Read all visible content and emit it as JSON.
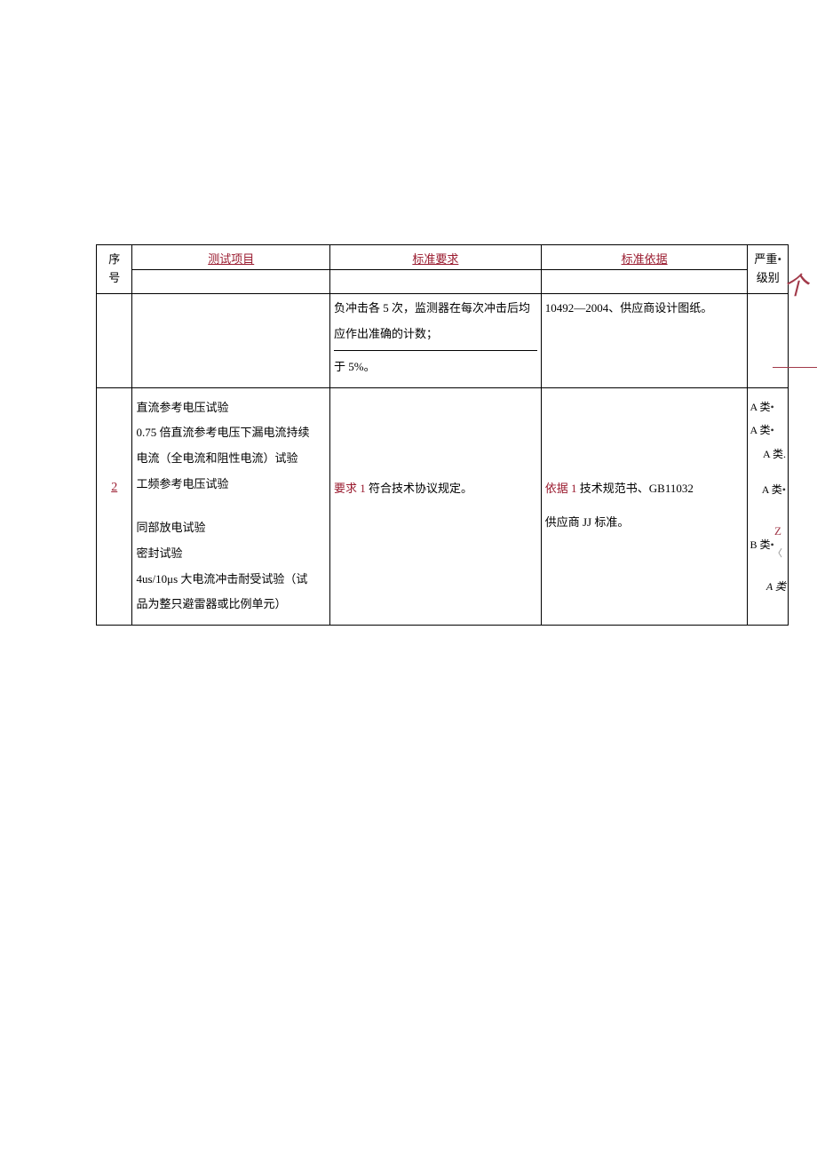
{
  "headers": {
    "seq": "序\n号",
    "seq_top": "序",
    "seq_bot": "号",
    "item": "测试项目",
    "req": "标准要求",
    "basis": "标准依据",
    "sev": "严重",
    "sev_top": "严重",
    "sev_bot": "级别"
  },
  "row1": {
    "req_top": "负冲击各 5 次，监测器在每次冲击后均应作出准确的计数；",
    "req_bot": "于 5%。",
    "basis": "10492—2004、供应商设计图纸。"
  },
  "row2": {
    "seq": "2",
    "item_top": "直流参考电压试验\n0.75 倍直流参考电压下漏电流持续电流（全电流和阻性电流）试验\n工频参考电压试验",
    "item_line1": "直流参考电压试验",
    "item_line2": "0.75 倍直流参考电压下漏电流持续",
    "item_line3": "电流（全电流和阻性电流）试验",
    "item_line4": "工频参考电压试验",
    "req_red": "要求 1 ",
    "req_rest": "符合技术协议规定。",
    "basis_red": "依据 1 ",
    "basis_rest": "技术规范书、GB11032",
    "basis_line2": "供应商 JJ 标准。",
    "item_bot_line1": "同部放电试验",
    "item_bot_line2": "密封试验",
    "item_bot_line3": "4us/10μs 大电流冲击耐受试验（试",
    "item_bot_line4": "品为整只避雷器或比例单元）",
    "sev": {
      "l1": "A 类",
      "l2": "A 类",
      "l3": "A 类.",
      "l4": "A 类",
      "l5": "B 类",
      "l6": "A 类"
    }
  },
  "annotations": {
    "glyph": "个",
    "z": "Z",
    "bracket": "〈"
  }
}
